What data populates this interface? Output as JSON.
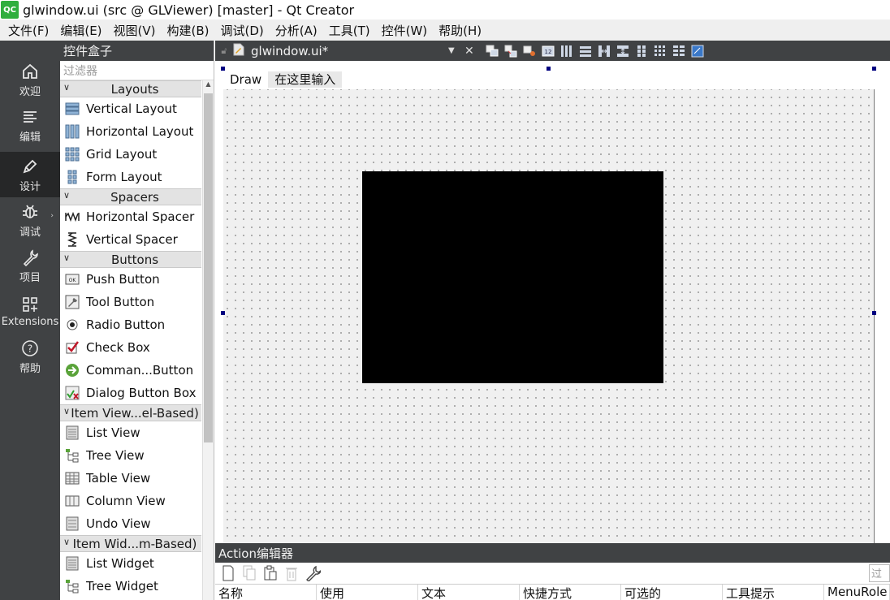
{
  "window": {
    "title": "glwindow.ui (src @ GLViewer) [master] - Qt Creator",
    "logo_text": "QC",
    "accent": "#2fae3e"
  },
  "menubar": [
    "文件(F)",
    "编辑(E)",
    "视图(V)",
    "构建(B)",
    "调试(D)",
    "分析(A)",
    "工具(T)",
    "控件(W)",
    "帮助(H)"
  ],
  "modes": [
    {
      "label": "欢迎",
      "icon": "home-icon"
    },
    {
      "label": "编辑",
      "icon": "edit-lines-icon"
    },
    {
      "label": "设计",
      "icon": "pen-icon",
      "active": true
    },
    {
      "label": "调试",
      "icon": "bug-icon"
    },
    {
      "label": "项目",
      "icon": "wrench-icon"
    },
    {
      "label": "Extensions",
      "icon": "extensions-icon"
    },
    {
      "label": "帮助",
      "icon": "help-icon"
    }
  ],
  "widgetbox": {
    "title": "控件盒子",
    "filter_placeholder": "过滤器",
    "categories": [
      {
        "name": "Layouts",
        "items": [
          "Vertical Layout",
          "Horizontal Layout",
          "Grid Layout",
          "Form Layout"
        ]
      },
      {
        "name": "Spacers",
        "items": [
          "Horizontal Spacer",
          "Vertical Spacer"
        ]
      },
      {
        "name": "Buttons",
        "items": [
          "Push Button",
          "Tool Button",
          "Radio Button",
          "Check Box",
          "Comman...Button",
          "Dialog Button Box"
        ]
      },
      {
        "name": "Item View...el-Based)",
        "items": [
          "List View",
          "Tree View",
          "Table View",
          "Column View",
          "Undo View"
        ]
      },
      {
        "name": "Item Wid...m-Based)",
        "items": [
          "List Widget",
          "Tree Widget"
        ]
      }
    ]
  },
  "editor": {
    "file_name": "glwindow.ui*",
    "form_menu": {
      "item": "Draw",
      "input": "在这里输入"
    }
  },
  "action_editor": {
    "title": "Action编辑器",
    "filter_placeholder": "过滤",
    "columns": [
      "名称",
      "使用",
      "文本",
      "快捷方式",
      "可选的",
      "工具提示",
      "MenuRole"
    ]
  }
}
